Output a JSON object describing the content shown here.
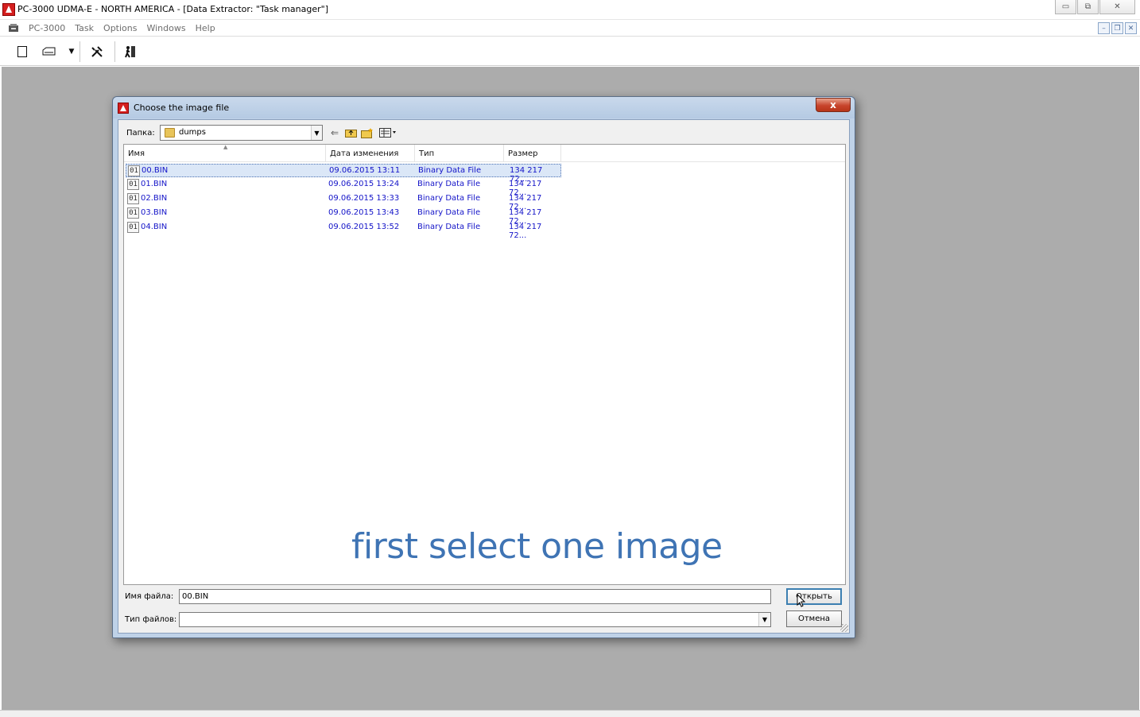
{
  "window": {
    "title": "PC-3000 UDMA-E - NORTH AMERICA - [Data Extractor: \"Task manager\"]",
    "buttons": {
      "minimize": "▭",
      "maximize": "⧉",
      "close": "✕"
    }
  },
  "menubar": {
    "items": [
      "PC-3000",
      "Task",
      "Options",
      "Windows",
      "Help"
    ],
    "mdi_buttons": {
      "minimize": "–",
      "restore": "❐",
      "close": "✕"
    }
  },
  "toolbar": {
    "icons": [
      "new-document-icon",
      "drive-icon",
      "dropdown-arrow-icon",
      "tools-icon",
      "exit-icon"
    ]
  },
  "dialog": {
    "title": "Choose the image file",
    "close_label": "x",
    "look_in_label": "Папка:",
    "look_in_value": "dumps",
    "columns": [
      "Имя",
      "Дата изменения",
      "Тип",
      "Размер"
    ],
    "files": [
      {
        "name": "00.BIN",
        "date": "09.06.2015 13:11",
        "type": "Binary Data File",
        "size": "134 217 72..."
      },
      {
        "name": "01.BIN",
        "date": "09.06.2015 13:24",
        "type": "Binary Data File",
        "size": "134 217 72..."
      },
      {
        "name": "02.BIN",
        "date": "09.06.2015 13:33",
        "type": "Binary Data File",
        "size": "134 217 72..."
      },
      {
        "name": "03.BIN",
        "date": "09.06.2015 13:43",
        "type": "Binary Data File",
        "size": "134 217 72..."
      },
      {
        "name": "04.BIN",
        "date": "09.06.2015 13:52",
        "type": "Binary Data File",
        "size": "134 217 72..."
      }
    ],
    "selected_index": 0,
    "file_icon_text": "01",
    "hint_overlay": "first select one image",
    "file_name_label": "Имя файла:",
    "file_name_value": "00.BIN",
    "file_type_label": "Тип файлов:",
    "file_type_value": "",
    "open_button": "Открыть",
    "cancel_button": "Отмена"
  }
}
